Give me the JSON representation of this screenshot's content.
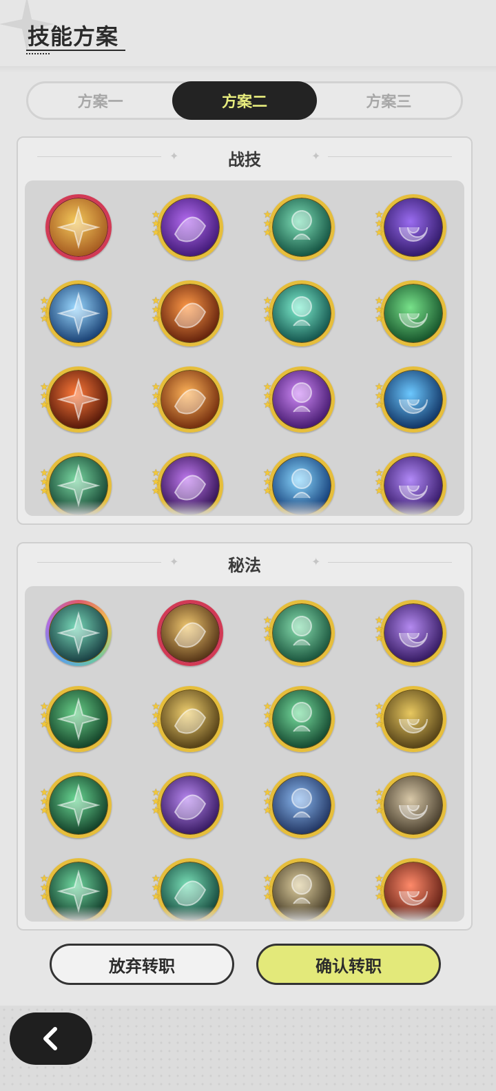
{
  "header": {
    "title": "技能方案"
  },
  "tabs": [
    {
      "label": "方案一",
      "active": false
    },
    {
      "label": "方案二",
      "active": true
    },
    {
      "label": "方案三",
      "active": false
    }
  ],
  "sections": [
    {
      "title": "战技",
      "skills": [
        {
          "icon": "golem-guard-icon",
          "stars": 0,
          "frame": "red",
          "colors": [
            "#f4c95b",
            "#a0531c"
          ]
        },
        {
          "icon": "violet-spark-icon",
          "stars": 3,
          "frame": "gold",
          "colors": [
            "#b46cf0",
            "#3a1470"
          ]
        },
        {
          "icon": "green-aura-figure-icon",
          "stars": 3,
          "frame": "gold",
          "colors": [
            "#7fe0b8",
            "#0d4a3a"
          ]
        },
        {
          "icon": "purple-vortex-icon",
          "stars": 3,
          "frame": "gold",
          "colors": [
            "#9a6cf0",
            "#2a1460"
          ]
        },
        {
          "icon": "ice-burst-icon",
          "stars": 3,
          "frame": "gold",
          "colors": [
            "#9ad8ff",
            "#10366a"
          ]
        },
        {
          "icon": "flame-swirl-icon",
          "stars": 3,
          "frame": "gold",
          "colors": [
            "#ff9a48",
            "#5a1a08"
          ]
        },
        {
          "icon": "teal-whirlpool-icon",
          "stars": 3,
          "frame": "gold",
          "colors": [
            "#7ff0d0",
            "#0c4a44"
          ]
        },
        {
          "icon": "green-healing-cross-icon",
          "stars": 3,
          "frame": "gold",
          "colors": [
            "#78e28a",
            "#0f4a24"
          ]
        },
        {
          "icon": "fireball-icon",
          "stars": 3,
          "frame": "gold",
          "colors": [
            "#ff7a3a",
            "#4a1206"
          ]
        },
        {
          "icon": "fire-phoenix-icon",
          "stars": 3,
          "frame": "gold",
          "colors": [
            "#ffb45a",
            "#6a2408"
          ]
        },
        {
          "icon": "violet-shard-burst-icon",
          "stars": 3,
          "frame": "gold",
          "colors": [
            "#d08af8",
            "#3c1266"
          ]
        },
        {
          "icon": "blue-spirit-flame-icon",
          "stars": 3,
          "frame": "gold",
          "colors": [
            "#6cc8ff",
            "#0a2a5a"
          ]
        },
        {
          "icon": "thorn-vine-icon",
          "stars": 3,
          "frame": "gold",
          "colors": [
            "#7ad8a2",
            "#0e3a2a"
          ]
        },
        {
          "icon": "void-eye-icon",
          "stars": 3,
          "frame": "gold",
          "colors": [
            "#c07af0",
            "#2a0c4a"
          ]
        },
        {
          "icon": "ice-crystal-icon",
          "stars": 3,
          "frame": "gold",
          "colors": [
            "#8ad8ff",
            "#0c3470"
          ]
        },
        {
          "icon": "arcane-sigil-icon",
          "stars": 3,
          "frame": "gold",
          "colors": [
            "#b28af8",
            "#2e1260"
          ]
        }
      ]
    },
    {
      "title": "秘法",
      "skills": [
        {
          "icon": "spirit-figure-icon",
          "stars": 0,
          "frame": "rainbow",
          "colors": [
            "#78d8b8",
            "#12343a"
          ]
        },
        {
          "icon": "golden-figure-icon",
          "stars": 0,
          "frame": "red",
          "colors": [
            "#f0c870",
            "#4a2a10"
          ]
        },
        {
          "icon": "green-shield-icon",
          "stars": 3,
          "frame": "gold",
          "colors": [
            "#88e0b0",
            "#124a34"
          ]
        },
        {
          "icon": "violet-arm-icon",
          "stars": 3,
          "frame": "gold",
          "colors": [
            "#b48af0",
            "#2c1258"
          ]
        },
        {
          "icon": "winged-emblem-icon",
          "stars": 3,
          "frame": "gold",
          "colors": [
            "#6ad08a",
            "#0e3a22"
          ]
        },
        {
          "icon": "golden-upward-beam-icon",
          "stars": 3,
          "frame": "gold",
          "colors": [
            "#f0d070",
            "#4a3610"
          ]
        },
        {
          "icon": "green-heart-icon",
          "stars": 3,
          "frame": "gold",
          "colors": [
            "#78e0a0",
            "#0e3e28"
          ]
        },
        {
          "icon": "golden-wings-icon",
          "stars": 3,
          "frame": "gold",
          "colors": [
            "#e8c860",
            "#4a3812"
          ]
        },
        {
          "icon": "green-sparkle-icon",
          "stars": 3,
          "frame": "gold",
          "colors": [
            "#6ad894",
            "#0c3420"
          ]
        },
        {
          "icon": "purple-swirl-icon",
          "stars": 3,
          "frame": "gold",
          "colors": [
            "#b888f0",
            "#2e1258"
          ]
        },
        {
          "icon": "blue-crystal-armor-icon",
          "stars": 3,
          "frame": "gold",
          "colors": [
            "#8ab8f0",
            "#1a2c58"
          ]
        },
        {
          "icon": "sepia-figure-icon",
          "stars": 3,
          "frame": "gold",
          "colors": [
            "#d8c8a8",
            "#3e3424"
          ]
        },
        {
          "icon": "green-rune-icon",
          "stars": 3,
          "frame": "gold",
          "colors": [
            "#70d8a0",
            "#0c3424"
          ]
        },
        {
          "icon": "clover-emblem-icon",
          "stars": 3,
          "frame": "gold",
          "colors": [
            "#7ae0b8",
            "#0e3e34"
          ]
        },
        {
          "icon": "golden-arrow-ring-icon",
          "stars": 3,
          "frame": "gold",
          "colors": [
            "#e0d0a0",
            "#3e3420"
          ]
        },
        {
          "icon": "red-flame-figure-icon",
          "stars": 3,
          "frame": "gold",
          "colors": [
            "#ff8a6a",
            "#5a1a10"
          ]
        }
      ]
    }
  ],
  "buttons": {
    "cancel": "放弃转职",
    "confirm": "确认转职"
  },
  "colors": {
    "accent": "#e3e97a",
    "tab_active_bg": "#232323",
    "tab_active_text": "#e7ec7d",
    "frame_gold": "#e6be3b",
    "frame_red": "#d23a55"
  }
}
